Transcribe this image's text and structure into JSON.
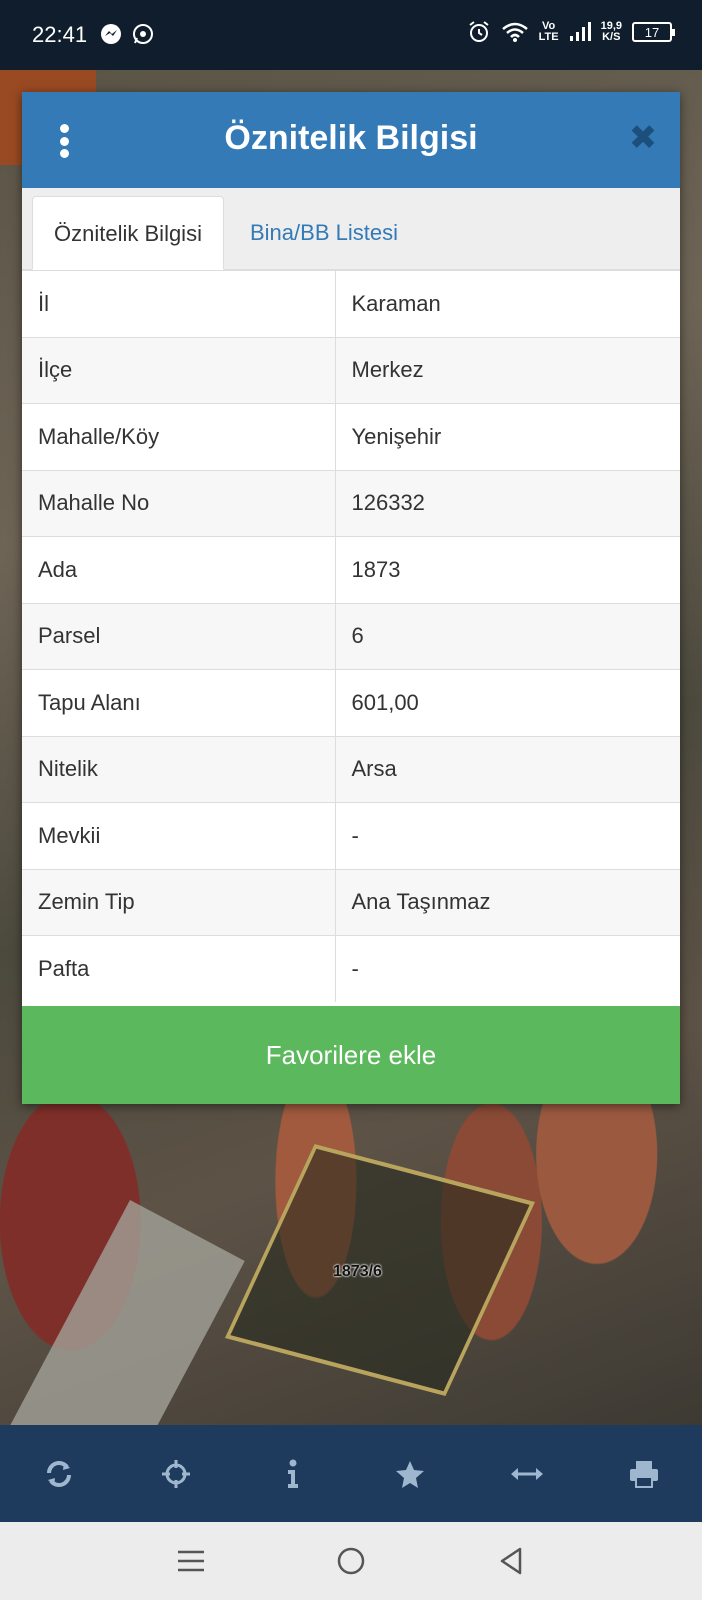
{
  "status_bar": {
    "time": "22:41",
    "network_top": "Vo",
    "network_bottom": "LTE",
    "speed_top": "19,9",
    "speed_bottom": "K/S",
    "battery": "17"
  },
  "map": {
    "parcel_label": "1873/6"
  },
  "dialog": {
    "title": "Öznitelik Bilgisi",
    "tabs": [
      {
        "label": "Öznitelik Bilgisi",
        "active": true
      },
      {
        "label": "Bina/BB Listesi",
        "active": false
      }
    ],
    "rows": [
      {
        "key": "İl",
        "value": "Karaman"
      },
      {
        "key": "İlçe",
        "value": "Merkez"
      },
      {
        "key": "Mahalle/Köy",
        "value": "Yenişehir"
      },
      {
        "key": "Mahalle No",
        "value": "126332"
      },
      {
        "key": "Ada",
        "value": "1873"
      },
      {
        "key": "Parsel",
        "value": "6"
      },
      {
        "key": "Tapu Alanı",
        "value": "601,00"
      },
      {
        "key": "Nitelik",
        "value": "Arsa"
      },
      {
        "key": "Mevkii",
        "value": "-"
      },
      {
        "key": "Zemin Tip",
        "value": "Ana Taşınmaz"
      },
      {
        "key": "Pafta",
        "value": "-"
      }
    ],
    "favorite_label": "Favorilere ekle"
  },
  "toolbar": {
    "icons": [
      "refresh-icon",
      "locate-icon",
      "info-icon",
      "star-icon",
      "measure-icon",
      "print-icon"
    ]
  },
  "colors": {
    "header": "#337ab7",
    "button": "#5cb85c",
    "toolbar": "#1e3a5c"
  }
}
